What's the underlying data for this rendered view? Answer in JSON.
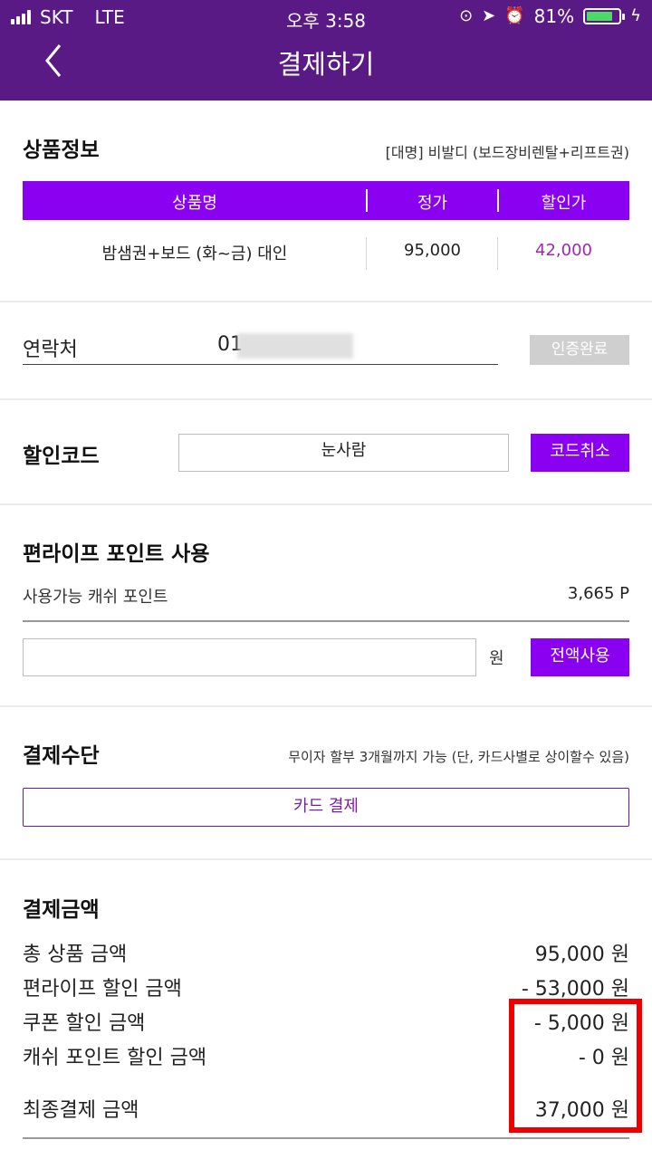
{
  "status_bar": {
    "carrier": "SKT",
    "network": "LTE",
    "time": "오후 3:58",
    "battery": "81%",
    "battery_level": 0.81
  },
  "nav": {
    "title": "결제하기"
  },
  "product_info": {
    "title": "상품정보",
    "subtitle": "[대명] 비발디 (보드장비렌탈+리프트권)",
    "columns": [
      "상품명",
      "정가",
      "할인가"
    ],
    "rows": [
      {
        "name": "밤샘권+보드 (화~금) 대인",
        "price": "95,000",
        "discount_price": "42,000"
      }
    ]
  },
  "contact": {
    "label": "연락처",
    "value": "01",
    "verify_label": "인증완료"
  },
  "discount_code": {
    "label": "할인코드",
    "value": "눈사람",
    "cancel_label": "코드취소"
  },
  "points": {
    "title": "편라이프 포인트 사용",
    "available_label": "사용가능 캐쉬 포인트",
    "available_value": "3,665 P",
    "input_value": "",
    "unit": "원",
    "use_all_label": "전액사용"
  },
  "payment_method": {
    "title": "결제수단",
    "note": "무이자 할부 3개월까지 가능 (단, 카드사별로 상이할수 있음)",
    "card_label": "카드 결제"
  },
  "payment_amount": {
    "title": "결제금액",
    "lines": [
      {
        "label": "총 상품 금액",
        "value": "95,000 원"
      },
      {
        "label": "편라이프 할인 금액",
        "value": "- 53,000 원"
      },
      {
        "label": "쿠폰 할인 금액",
        "value": "- 5,000 원"
      },
      {
        "label": "캐쉬 포인트 할인 금액",
        "value": "- 0 원"
      }
    ],
    "final_label": "최종결제 금액",
    "final_value": "37,000 원"
  },
  "colors": {
    "header": "#5a1a86",
    "accent": "#8a00f0",
    "highlight": "#ee0000"
  }
}
